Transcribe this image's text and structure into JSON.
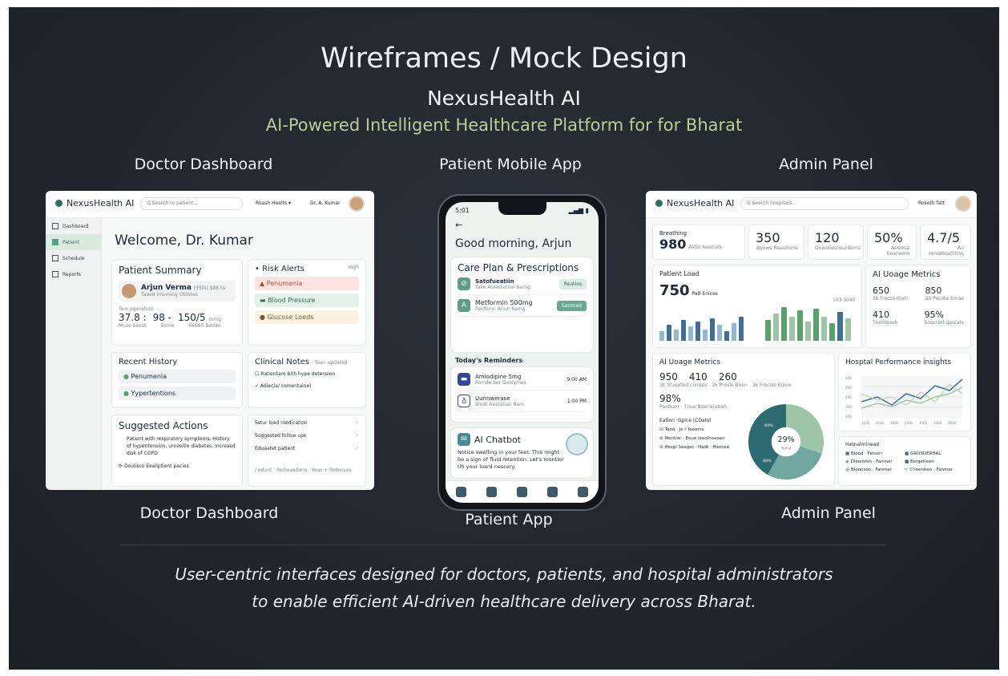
{
  "header": {
    "title": "Wireframes / Mock Design",
    "brand": "NexusHealth AI",
    "tagline": "AI-Powered Intelligent Healthcare Platform for for Bharat"
  },
  "sections": {
    "doctor_top": "Doctor Dashboard",
    "patient_top": "Patient Mobile App",
    "admin_top": "Admin Panel",
    "doctor_bottom": "Doctor Dashboard",
    "patient_bottom": "Patient App",
    "admin_bottom": "Admin Panel"
  },
  "footer": {
    "line1": "User-centric interfaces designed for doctors, patients, and hospital administrators",
    "line2": "to enable efficient AI-driven healthcare delivery across Bharat."
  },
  "doctor": {
    "logo": "NexusHealth AI",
    "search_placeholder": "Q Search to patient...",
    "menu_label": "Roash Heelts",
    "user_label": "Dr. A. Kumar",
    "sidebar": [
      "Dashboard",
      "Patient",
      "Schedule",
      "Reports"
    ],
    "welcome": "Welcome, Dr. Kumar",
    "summary": {
      "title": "Patient Summary",
      "name": "Arjun Verma",
      "name_meta": "(55fo)  $86 to",
      "condition": "Taaed Imoming Obietes",
      "vitals_label": "Tem pgerature",
      "temp": "37.8 :",
      "pulse": "98 -",
      "bp": "150/5",
      "bp_unit": "mmg",
      "temp_sub": "Muso boest",
      "pulse_sub": "3omo",
      "bp_sub": "56665 Betian"
    },
    "risk": {
      "title": "• Risk Alerts",
      "level": "High",
      "items": [
        "Penumenia",
        "Blood Pressure",
        "Glucose Loeds"
      ]
    },
    "history": {
      "title": "Recent History",
      "items": [
        "Penumenia",
        "Yypertentions"
      ]
    },
    "notes": {
      "title": "Clinical Notes",
      "title_meta": "· Tean updated",
      "items": [
        "Ratientare bith hype detension",
        "Adiecia/ comentaine)"
      ]
    },
    "actions": {
      "title": "Suggested Actions",
      "text": "Patient with respiratory symptoms. History of hypentension, unresitle diabetes. Increasd disk of COPD",
      "footer": "Doulisco Eealiptient pacies",
      "checks": [
        "Sstur load medication",
        "Suggested follow ups",
        "Eduaatet patient"
      ],
      "right_footer": "/ edunt · Reiheasdons · Yous + Retenses"
    }
  },
  "phone": {
    "time": "5:01",
    "greeting": "Good morning, Arjun",
    "care_title": "Care Plan & Prescriptions",
    "meds": [
      {
        "name": "Satofueatiin",
        "detail": "Take Atoestation 6amg",
        "action": "Reatios"
      },
      {
        "name": "Metformin 500mg",
        "detail": "Fenfionn Arjun 6amg",
        "action": "Sentned"
      }
    ],
    "reminders_title": "Today's Reminders",
    "reminders": [
      {
        "name": "Amlodipine 5mg",
        "detail": "Femde ber Goolymes",
        "time": "9:00 AM"
      },
      {
        "name": "Uunnwerase",
        "detail": "Bloot Aestatian 8am",
        "time": "1:00 PM"
      }
    ],
    "chat_title": "AI Chatbot",
    "chat_text": "Notice swelling in your feet. This might be a sign of fluid retention. Let's montior tlh your loard nescery."
  },
  "admin": {
    "logo": "NexusHealth AI",
    "search_placeholder": "Q Search hospitals...",
    "menu_label": "Roseth fatt",
    "stats": [
      {
        "label": "Breathing",
        "value": "980",
        "sub": "Astin Aeatiuts"
      },
      {
        "value": "350",
        "sub": "Apows Reautions"
      },
      {
        "value": "120",
        "sub": "Doweliestisuntoms"
      },
      {
        "value": "50%",
        "sub": "Aesiesa boaneom"
      },
      {
        "value": "4.7/5",
        "sub": "Au senseteatiiting"
      }
    ],
    "load": {
      "title": "Patient Load",
      "big": "750",
      "big_label": "Patl Enicse",
      "annot": "103 3045"
    },
    "usage1": {
      "title": "AI Uoage Metrics",
      "items": [
        {
          "value": "650",
          "sub": "3k Frecsentiatr"
        },
        {
          "value": "850",
          "sub": "3b Pecate Emoe"
        },
        {
          "value": "410",
          "sub": "Tnohtsoeh"
        },
        {
          "value": "95%",
          "sub": "Soocrtet Geslats"
        }
      ]
    },
    "usage2": {
      "title": "AI Uoage Metrics",
      "values": [
        "950",
        "410",
        "260"
      ],
      "subs": [
        "3k Sfueeted condes",
        "3k Presle Boon",
        "3k Frecsie Emoe"
      ],
      "pct": "98%",
      "pct_sub": "Pootkarr · Tnue Boenaiizeah",
      "legend_title": "Eatlon ·Gplce (COats)",
      "legend": [
        "Tood · Je r feeoms",
        "Montior · Eoue leeolhoeoen",
        "Hospl Seaget · Hadt · Hancee"
      ],
      "donut_center": "29%",
      "donut_sub": "Tomd",
      "donut_labels": [
        "60%",
        "60%"
      ]
    },
    "perf": {
      "title": "Hosptal Performance insights",
      "x_ticks": [
        "1100",
        "2200",
        "2000",
        "2400",
        "3000",
        "3400",
        "3000"
      ],
      "y_ticks": [
        "300",
        "200",
        "200",
        "300",
        "300"
      ],
      "legend_title": "Hetnalminead",
      "legend": [
        "Blood · Fatsori",
        "GROSDERHAL",
        "Dieemion · Fanmer",
        "Eergetieen",
        "Bloonson · Fanmer",
        "Choenben · Fanmer"
      ]
    },
    "colors": {
      "accent": "#2f6f62",
      "teal_dark": "#2d6a72",
      "teal_mid": "#6fa8a0",
      "green": "#58a36a",
      "sage": "#9cc6a6",
      "blue": "#3f6f94"
    }
  }
}
